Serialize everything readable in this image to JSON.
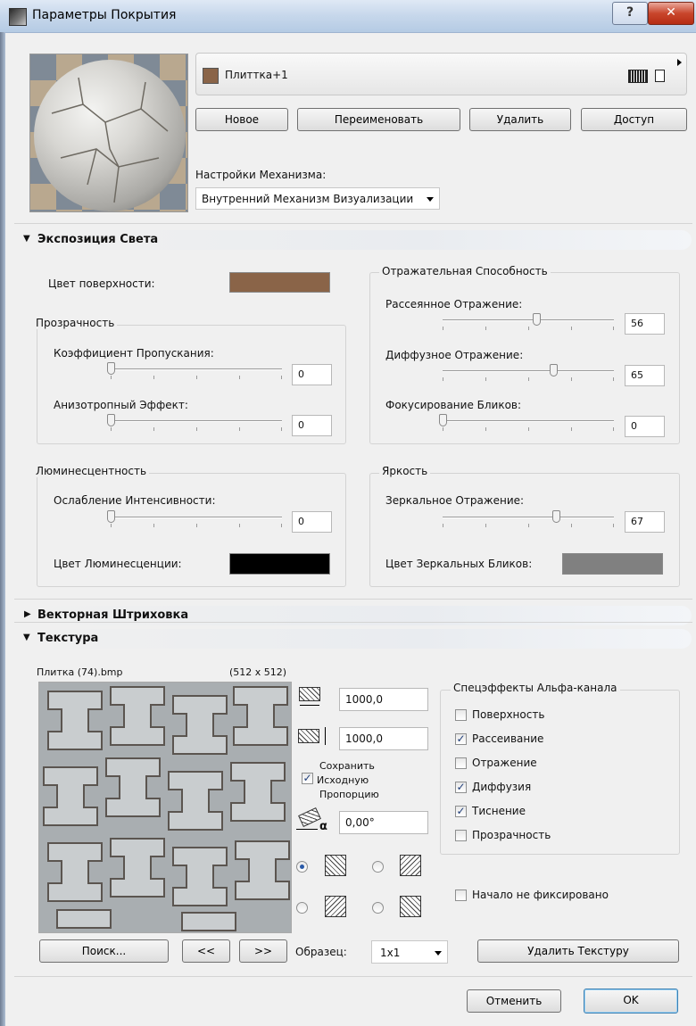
{
  "window": {
    "title": "Параметры Покрытия",
    "help_label": "?",
    "close_label": "✕"
  },
  "material": {
    "name": "Плиттка+1",
    "swatch_color": "#8a6448"
  },
  "buttons": {
    "new": "Новое",
    "rename": "Переименовать",
    "delete": "Удалить",
    "access": "Доступ"
  },
  "engine": {
    "label": "Настройки Механизма:",
    "value": "Внутренний Механизм Визуализации"
  },
  "sections": {
    "exposure": "Экспозиция Света",
    "vector_hatch": "Векторная Штриховка",
    "texture": "Текстура"
  },
  "exposure": {
    "surface_color_label": "Цвет поверхности:",
    "surface_color": "#8a6448",
    "transparency": {
      "title": "Прозрачность",
      "transmission_label": "Коэффициент Пропускания:",
      "transmission_value": "0",
      "anisotropy_label": "Анизотропный Эффект:",
      "anisotropy_value": "0"
    },
    "luminance": {
      "title": "Люминесцентность",
      "falloff_label": "Ослабление Интенсивности:",
      "falloff_value": "0",
      "color_label": "Цвет Люминесценции:",
      "color": "#000000"
    },
    "reflectivity": {
      "title": "Отражательная Способность",
      "ambient_label": "Рассеянное Отражение:",
      "ambient_value": "56",
      "diffuse_label": "Диффузное Отражение:",
      "diffuse_value": "65",
      "focus_label": "Фокусирование Бликов:",
      "focus_value": "0"
    },
    "brightness": {
      "title": "Яркость",
      "specular_label": "Зеркальное Отражение:",
      "specular_value": "67",
      "color_label": "Цвет Зеркальных Бликов:",
      "color": "#808080"
    }
  },
  "texture": {
    "file_name": "Плитка (74).bmp",
    "file_size": "(512 x 512)",
    "width_value": "1000,0",
    "height_value": "1000,0",
    "keep_ratio_label": "Сохранить Исходную Пропорцию",
    "keep_ratio_lines": [
      "Сохранить",
      "Исходную",
      "Пропорцию"
    ],
    "keep_ratio_checked": true,
    "angle_value": "0,00°",
    "alpha": {
      "title": "Спецэффекты Альфа-канала",
      "options": [
        {
          "label": "Поверхность",
          "checked": false
        },
        {
          "label": "Рассеивание",
          "checked": true
        },
        {
          "label": "Отражение",
          "checked": false
        },
        {
          "label": "Диффузия",
          "checked": true
        },
        {
          "label": "Тиснение",
          "checked": true
        },
        {
          "label": "Прозрачность",
          "checked": false
        }
      ]
    },
    "origin_label": "Начало не фиксировано",
    "origin_checked": false,
    "search_label": "Поиск...",
    "prev_label": "<<",
    "next_label": ">>",
    "sample_label": "Образец:",
    "sample_value": "1x1",
    "remove_label": "Удалить Текстуру"
  },
  "footer": {
    "cancel": "Отменить",
    "ok": "OK"
  }
}
